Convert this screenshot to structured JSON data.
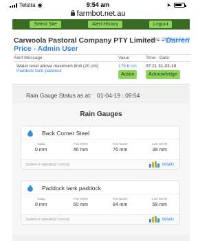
{
  "status_bar": {
    "carrier": "Telstra",
    "time": "9:54 am"
  },
  "browser": {
    "url": "farmbot.net.au"
  },
  "nav": {
    "select_site": "Select Site",
    "alert_history": "Alert History",
    "logout": "Logout"
  },
  "company": {
    "name": "Carwoola Pastoral Company PTY Limited",
    "separator": " - - ",
    "user": "Darren Price - Admin User",
    "date_label": "Date:",
    "date_value": "09:54 01-04-19"
  },
  "alerts": {
    "headers": {
      "message": "Alert Message",
      "value": "Value",
      "time": "Time - Date"
    },
    "rows": [
      {
        "message": "Water level above maximum limit (20 cm)",
        "location": "Paddock tank paddock",
        "value": "179.6 cm",
        "action_label": "Action",
        "time_date": "07:21 31-03-19",
        "acknowledge_label": "Acknowledge"
      }
    ]
  },
  "rain": {
    "status_label": "Rain Gauge Status as at:",
    "status_datetime": "01-04-19 : 09:54",
    "panel_title": "Rain Gauges",
    "column_labels": {
      "today": "Today",
      "week": "This Week",
      "month": "This Month",
      "last_month": "Last Month"
    },
    "gauges": [
      {
        "name": "Back Corner Steel",
        "today": "0 mm",
        "week": "46 mm",
        "month": "76 mm",
        "last_month": "38 mm",
        "status": "System is operating correctly",
        "details_label": "details"
      },
      {
        "name": "Paddock tank paddock",
        "today": "0 mm",
        "week": "50 mm",
        "month": "84 mm",
        "last_month": "58 mm",
        "status": "System is operating correctly",
        "details_label": "details"
      }
    ]
  },
  "colors": {
    "nav_bg": "#3a6b24",
    "button_green": "#8ed45a",
    "link_blue": "#2f7fd8",
    "drop_blue": "#3a8fd6"
  }
}
